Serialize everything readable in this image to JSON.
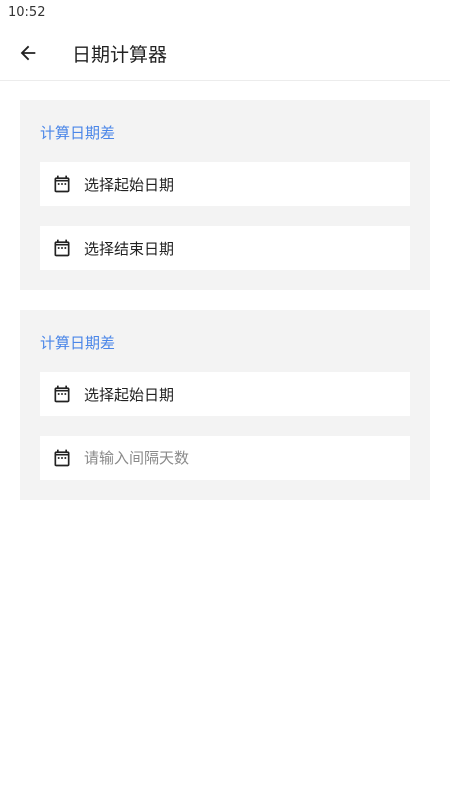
{
  "status_bar": {
    "time": "10:52"
  },
  "app_bar": {
    "title": "日期计算器",
    "back_icon": "arrow-left-icon"
  },
  "cards": [
    {
      "title": "计算日期差",
      "fields": [
        {
          "icon": "calendar-icon",
          "label": "选择起始日期"
        },
        {
          "icon": "calendar-icon",
          "label": "选择结束日期"
        }
      ]
    },
    {
      "title": "计算日期差",
      "fields": [
        {
          "icon": "calendar-icon",
          "label": "选择起始日期"
        },
        {
          "icon": "calendar-icon",
          "placeholder": "请输入间隔天数",
          "value": ""
        }
      ]
    }
  ],
  "colors": {
    "accent": "#4a86e8",
    "card_bg": "#f3f3f3",
    "field_bg": "#ffffff"
  }
}
